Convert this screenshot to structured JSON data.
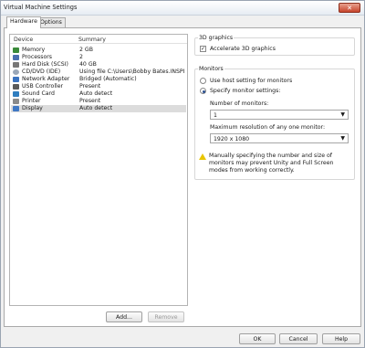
{
  "window": {
    "title": "Virtual Machine Settings",
    "close_glyph": "✕"
  },
  "tabs": [
    {
      "label": "Hardware",
      "active": true
    },
    {
      "label": "Options",
      "active": false
    }
  ],
  "device_list": {
    "headers": {
      "device": "Device",
      "summary": "Summary"
    },
    "rows": [
      {
        "device": "Memory",
        "summary": "2 GB",
        "icon": "memory-icon",
        "color": "#3a8a3a"
      },
      {
        "device": "Processors",
        "summary": "2",
        "icon": "processor-icon",
        "color": "#4a6fae"
      },
      {
        "device": "Hard Disk (SCSI)",
        "summary": "40 GB",
        "icon": "hard-disk-icon",
        "color": "#777777"
      },
      {
        "device": "CD/DVD (IDE)",
        "summary": "Using file C:\\Users\\Bobby Bates.INSPI...",
        "icon": "cd-dvd-icon",
        "color": "#9aa7b8"
      },
      {
        "device": "Network Adapter",
        "summary": "Bridged (Automatic)",
        "icon": "network-adapter-icon",
        "color": "#3a73c0"
      },
      {
        "device": "USB Controller",
        "summary": "Present",
        "icon": "usb-controller-icon",
        "color": "#5a5a5a"
      },
      {
        "device": "Sound Card",
        "summary": "Auto detect",
        "icon": "sound-card-icon",
        "color": "#2f7dbf"
      },
      {
        "device": "Printer",
        "summary": "Present",
        "icon": "printer-icon",
        "color": "#8a8a8a"
      },
      {
        "device": "Display",
        "summary": "Auto detect",
        "icon": "display-icon",
        "color": "#3f78c4",
        "selected": true
      }
    ]
  },
  "buttons": {
    "add": "Add...",
    "remove": "Remove",
    "ok": "OK",
    "cancel": "Cancel",
    "help": "Help"
  },
  "graphics_3d": {
    "group_title": "3D graphics",
    "accelerate_label": "Accelerate 3D graphics",
    "accelerate_checked": true,
    "check_glyph": "✓"
  },
  "monitors": {
    "group_title": "Monitors",
    "use_host_label": "Use host setting for monitors",
    "specify_label": "Specify monitor settings:",
    "number_label": "Number of monitors:",
    "number_value": "1",
    "max_res_label": "Maximum resolution of any one monitor:",
    "max_res_value": "1920 x 1080",
    "dropdown_glyph": "▼",
    "warning": "Manually specifying the number and size of monitors may prevent Unity and Full Screen modes from working correctly."
  }
}
